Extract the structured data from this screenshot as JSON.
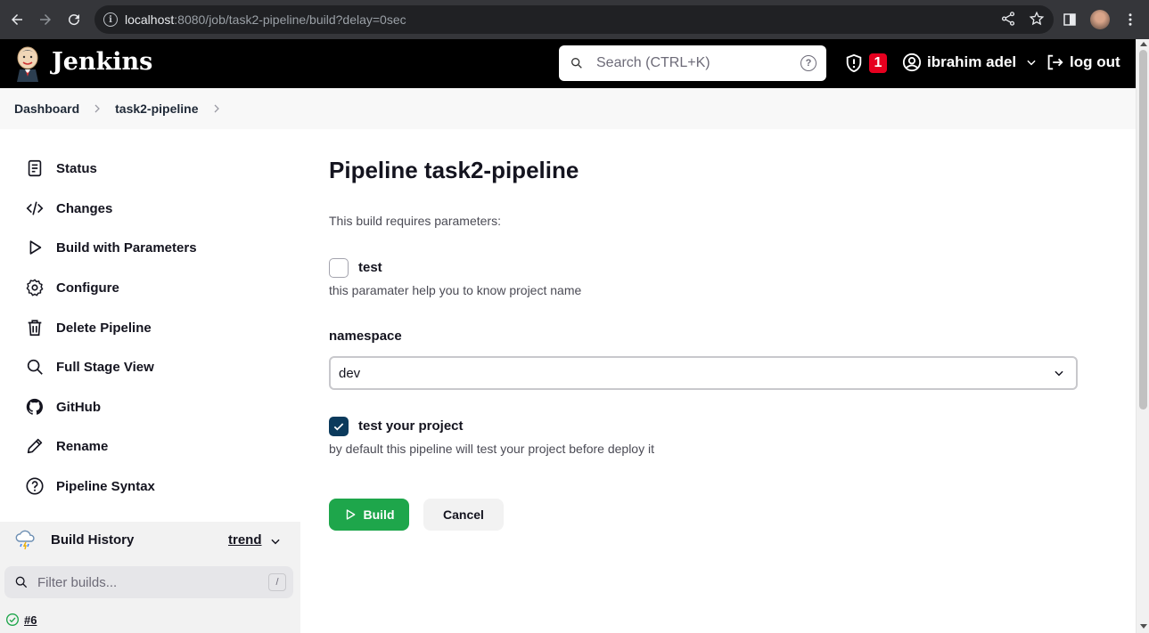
{
  "browser": {
    "url_host": "localhost",
    "url_rest": ":8080/job/task2-pipeline/build?delay=0sec"
  },
  "header": {
    "brand": "Jenkins",
    "search_placeholder": "Search (CTRL+K)",
    "security_count": "1",
    "user_name": "ibrahim adel",
    "logout_label": "log out"
  },
  "breadcrumb": {
    "items": [
      "Dashboard",
      "task2-pipeline"
    ]
  },
  "sidebar": {
    "items": [
      {
        "label": "Status",
        "icon": "document-icon"
      },
      {
        "label": "Changes",
        "icon": "code-icon"
      },
      {
        "label": "Build with Parameters",
        "icon": "play-icon"
      },
      {
        "label": "Configure",
        "icon": "gear-icon"
      },
      {
        "label": "Delete Pipeline",
        "icon": "trash-icon"
      },
      {
        "label": "Full Stage View",
        "icon": "search-icon"
      },
      {
        "label": "GitHub",
        "icon": "github-icon"
      },
      {
        "label": "Rename",
        "icon": "pencil-icon"
      },
      {
        "label": "Pipeline Syntax",
        "icon": "help-icon"
      }
    ],
    "build_history": {
      "title": "Build History",
      "trend_label": "trend",
      "filter_placeholder": "Filter builds...",
      "filter_shortcut": "/",
      "builds": [
        {
          "number": "#6",
          "status": "success"
        }
      ]
    }
  },
  "main": {
    "title": "Pipeline task2-pipeline",
    "subtitle": "This build requires parameters:",
    "params": {
      "test": {
        "label": "test",
        "checked": false,
        "description": "this paramater help you to know project name"
      },
      "namespace": {
        "label": "namespace",
        "value": "dev"
      },
      "test_project": {
        "label": "test your project",
        "checked": true,
        "description": "by default this pipeline will test your project before deploy it"
      }
    },
    "build_button": "Build",
    "cancel_button": "Cancel"
  },
  "colors": {
    "header_bg": "#000000",
    "build_green": "#1ea64b",
    "badge_red": "#e6001f",
    "checkbox_checked": "#0b3a5c"
  }
}
